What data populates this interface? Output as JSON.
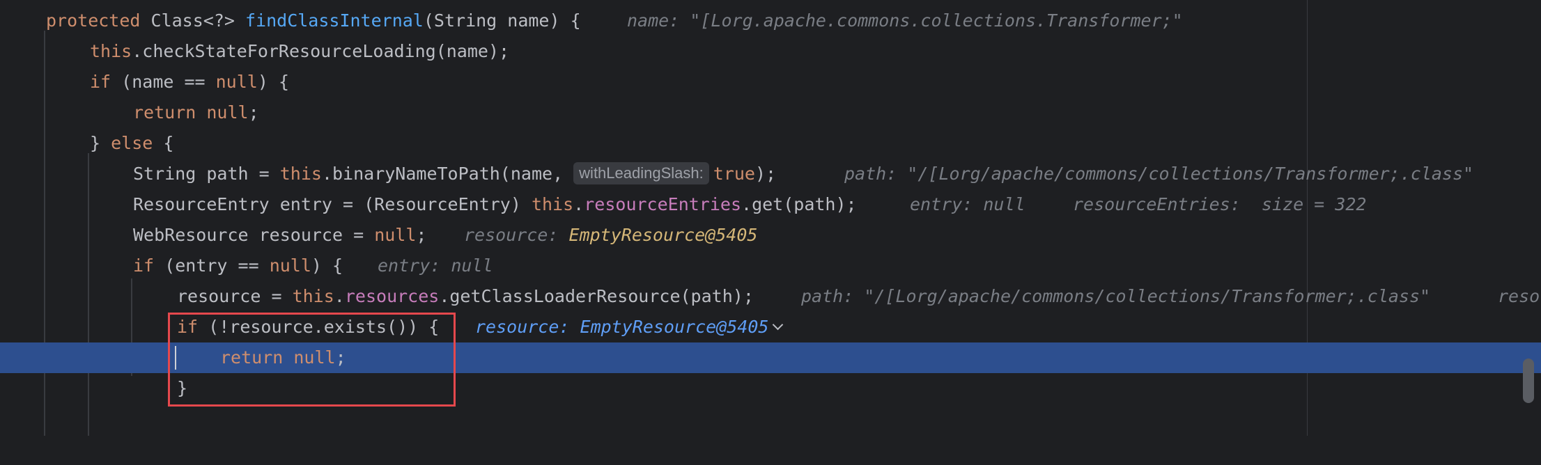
{
  "lines": {
    "l1": {
      "kw_protected": "protected ",
      "class_type": "Class<?> ",
      "method_name": "findClassInternal",
      "params": "(String name) {",
      "hint": "name: \"[Lorg.apache.commons.collections.Transformer;\""
    },
    "l2": {
      "kw_this": "this",
      "rest": ".checkStateForResourceLoading(name);"
    },
    "l3": {
      "kw_if": "if",
      "mid": " (name == ",
      "kw_null": "null",
      "end": ") {"
    },
    "l4": {
      "kw_return": "return ",
      "kw_null": "null",
      "end": ";"
    },
    "l5": {
      "brace": "} ",
      "kw_else": "else",
      "end": " {"
    },
    "l6": {
      "start": "String path = ",
      "kw_this": "this",
      "mid": ".binaryNameToPath(name, ",
      "param_hint": "withLeadingSlash:",
      "kw_true": "true",
      "end": ");",
      "hint": "path: \"/[Lorg/apache/commons/collections/Transformer;.class\""
    },
    "l7": {
      "start": "ResourceEntry entry = (ResourceEntry) ",
      "kw_this": "this",
      "dot": ".",
      "field": "resourceEntries",
      "end": ".get(path);",
      "hint1": "entry: null",
      "hint2": "resourceEntries:  size = 322"
    },
    "l8": {
      "start": "WebResource resource = ",
      "kw_null": "null",
      "end": ";",
      "hint_label": "resource: ",
      "hint_value": "EmptyResource@5405"
    },
    "l9": {
      "kw_if": "if",
      "mid": " (entry == ",
      "kw_null": "null",
      "end": ") {",
      "hint": "entry: null"
    },
    "l10": {
      "start": "resource = ",
      "kw_this": "this",
      "dot": ".",
      "field": "resources",
      "end": ".getClassLoaderResource(path);",
      "hint": "path: \"/[Lorg/apache/commons/collections/Transformer;.class\"",
      "hint_trail": "reso"
    },
    "l11": {
      "kw_if": "if",
      "end": " (!resource.exists()) {",
      "hint_value": "resource: EmptyResource@5405"
    },
    "l12": {
      "kw_return": "return ",
      "kw_null": "null",
      "end": ";"
    },
    "l13": {
      "brace": "}"
    }
  }
}
